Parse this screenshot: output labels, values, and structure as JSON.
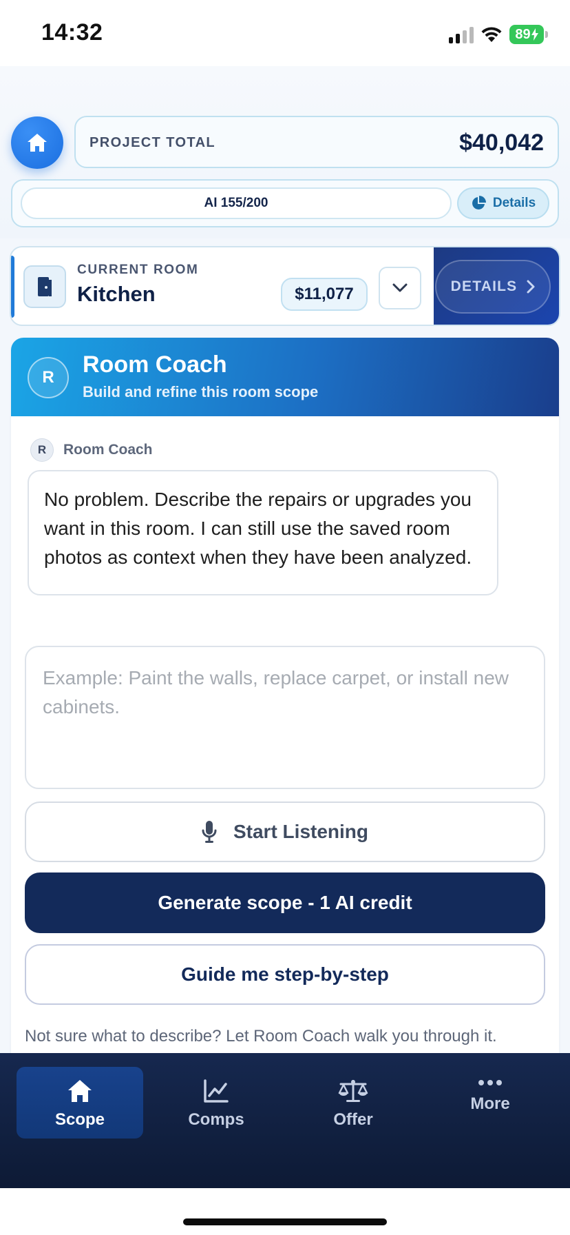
{
  "status_bar": {
    "time": "14:32",
    "battery": "89"
  },
  "header": {
    "project_total_label": "PROJECT TOTAL",
    "project_total_value": "$40,042",
    "ai_credits": "AI 155/200",
    "details_label": "Details"
  },
  "current_room": {
    "label": "CURRENT ROOM",
    "name": "Kitchen",
    "price": "$11,077",
    "details_label": "DETAILS"
  },
  "room_coach": {
    "avatar_letter": "R",
    "title": "Room Coach",
    "subtitle": "Build and refine this room scope",
    "message": {
      "avatar_letter": "R",
      "author": "Room Coach",
      "text": "No problem. Describe the repairs or upgrades you want in this room. I can still use the saved room photos as context when they have been analyzed."
    },
    "input": {
      "value": "",
      "placeholder": "Example: Paint the walls, replace carpet, or install new cabinets."
    },
    "listen_label": "Start Listening",
    "generate_label": "Generate scope - 1 AI credit",
    "guide_label": "Guide me step-by-step",
    "hint": "Not sure what to describe? Let Room Coach walk you through it."
  },
  "bottom_nav": {
    "items": [
      {
        "label": "Scope",
        "icon": "home-icon",
        "active": true
      },
      {
        "label": "Comps",
        "icon": "chart-line-icon",
        "active": false
      },
      {
        "label": "Offer",
        "icon": "scale-icon",
        "active": false
      },
      {
        "label": "More",
        "icon": "more-dots-icon",
        "active": false
      }
    ]
  },
  "colors": {
    "accent_blue": "#1b6fe0",
    "navy": "#132a5a",
    "battery_green": "#34c759"
  }
}
